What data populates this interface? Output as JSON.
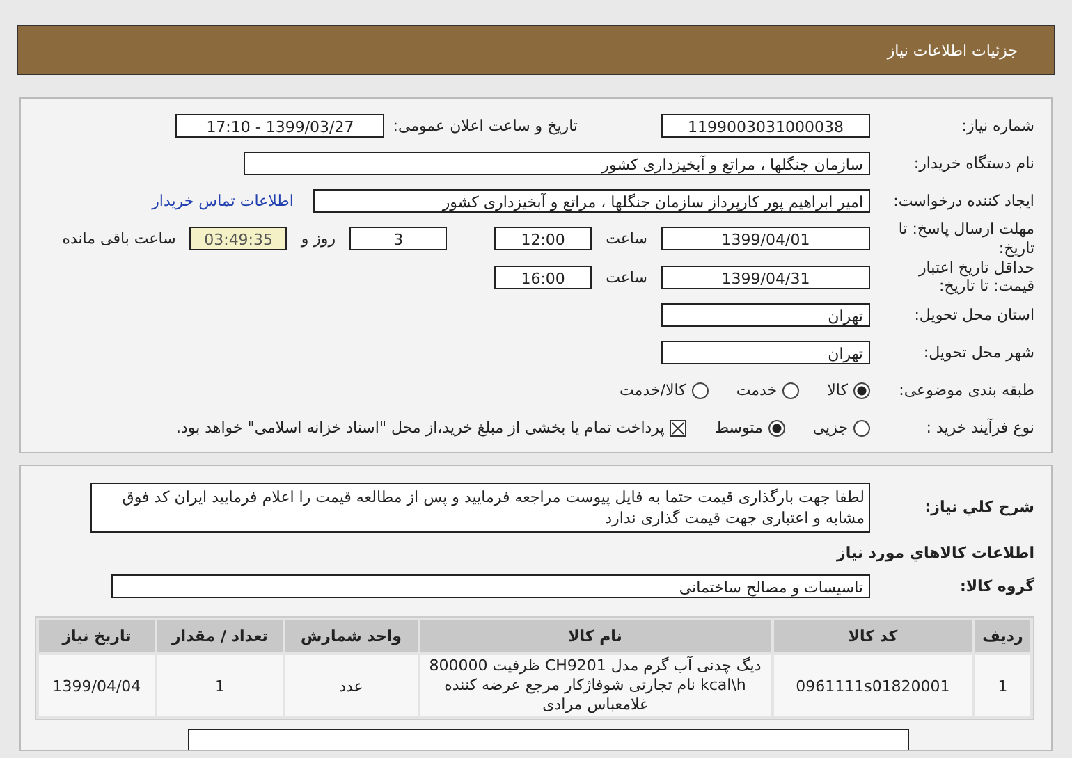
{
  "header": {
    "title": "جزئیات اطلاعات نیاز"
  },
  "need_number": {
    "label": "شماره نیاز:",
    "value": "1199003031000038"
  },
  "announce": {
    "label": "تاریخ و ساعت اعلان عمومی:",
    "value": "1399/03/27 - 17:10"
  },
  "buyer": {
    "label": "نام دستگاه خریدار:",
    "value": "سازمان جنگلها ، مراتع و آبخیزداری کشور"
  },
  "creator": {
    "label": "ایجاد کننده درخواست:",
    "value": "امیر  ابراهیم پور کارپرداز سازمان جنگلها ، مراتع و آبخیزداری کشور",
    "link": "اطلاعات تماس خریدار"
  },
  "deadline": {
    "label": "مهلت ارسال پاسخ: تا تاریخ:",
    "date": "1399/04/01",
    "time_label": "ساعت",
    "time": "12:00",
    "days": "3",
    "days_label": "روز و",
    "remaining": "03:49:35",
    "remaining_label": "ساعت باقی مانده"
  },
  "validity": {
    "label": "حداقل تاریخ اعتبار قیمت: تا تاریخ:",
    "date": "1399/04/31",
    "time_label": "ساعت",
    "time": "16:00"
  },
  "province": {
    "label": "استان محل تحویل:",
    "value": "تهران"
  },
  "city": {
    "label": "شهر محل تحویل:",
    "value": "تهران"
  },
  "category": {
    "label": "طبقه بندی موضوعی:",
    "options": [
      {
        "label": "کالا",
        "selected": true
      },
      {
        "label": "خدمت",
        "selected": false
      },
      {
        "label": "کالا/خدمت",
        "selected": false
      }
    ]
  },
  "process": {
    "label": "نوع فرآیند خرید :",
    "options": [
      {
        "label": "جزیی",
        "selected": false
      },
      {
        "label": "متوسط",
        "selected": true
      }
    ],
    "payment": {
      "checked": true,
      "text": "پرداخت تمام یا بخشی از مبلغ خرید،از محل \"اسناد خزانه اسلامی\" خواهد بود."
    }
  },
  "description": {
    "label": "شرح کلي نياز:",
    "value": "لطفا جهت بارگذاری قیمت حتما به فایل پیوست مراجعه فرمایید و پس از مطالعه قیمت را اعلام فرمایید ایران کد فوق مشابه و اعتباری جهت قیمت گذاری ندارد"
  },
  "goods_title": "اطلاعات کالاهاي مورد نياز",
  "goods_group": {
    "label": "گروه کالا:",
    "value": "تاسیسات و مصالح ساختمانی"
  },
  "table": {
    "columns": [
      "ردیف",
      "کد کالا",
      "نام کالا",
      "واحد شمارش",
      "تعداد / مقدار",
      "تاریخ نیاز"
    ],
    "rows": [
      [
        "1",
        "0961111s01820001",
        "دیگ چدنی آب گرم مدل CH9201 ظرفیت 800000 kcal\\h نام تجارتی شوفاژکار مرجع عرضه کننده غلامعباس مرادی",
        "عدد",
        "1",
        "1399/04/04"
      ]
    ]
  }
}
